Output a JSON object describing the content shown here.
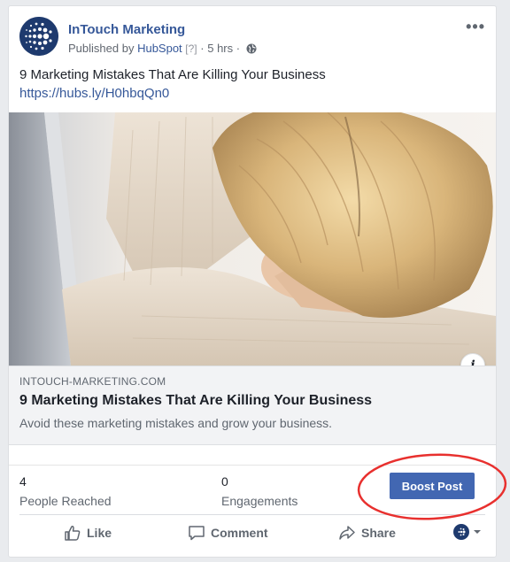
{
  "post": {
    "page_name": "InTouch Marketing",
    "published_by_prefix": "Published by",
    "publisher": "HubSpot",
    "help_marker": "[?]",
    "separator": "·",
    "time": "5 hrs",
    "separator2": "·",
    "text": "9 Marketing Mistakes That Are Killing Your Business",
    "url": "https://hubs.ly/H0hbqQn0",
    "more_icon": "more-horizontal-icon",
    "privacy_icon": "globe-icon"
  },
  "link_preview": {
    "domain": "INTOUCH-MARKETING.COM",
    "title": "9 Marketing Mistakes That Are Killing Your Business",
    "description": "Avoid these marketing mistakes and grow your business.",
    "info_label": "i"
  },
  "stats": {
    "reached_count": "4",
    "reached_label": "People Reached",
    "engagements_count": "0",
    "engagements_label": "Engagements"
  },
  "boost_button": {
    "label": "Boost Post",
    "color": "#4267b2"
  },
  "highlight": {
    "color": "#e8302e"
  },
  "actions": {
    "like": "Like",
    "comment": "Comment",
    "share": "Share"
  },
  "colors": {
    "link": "#365899",
    "background": "#e9ebee"
  }
}
